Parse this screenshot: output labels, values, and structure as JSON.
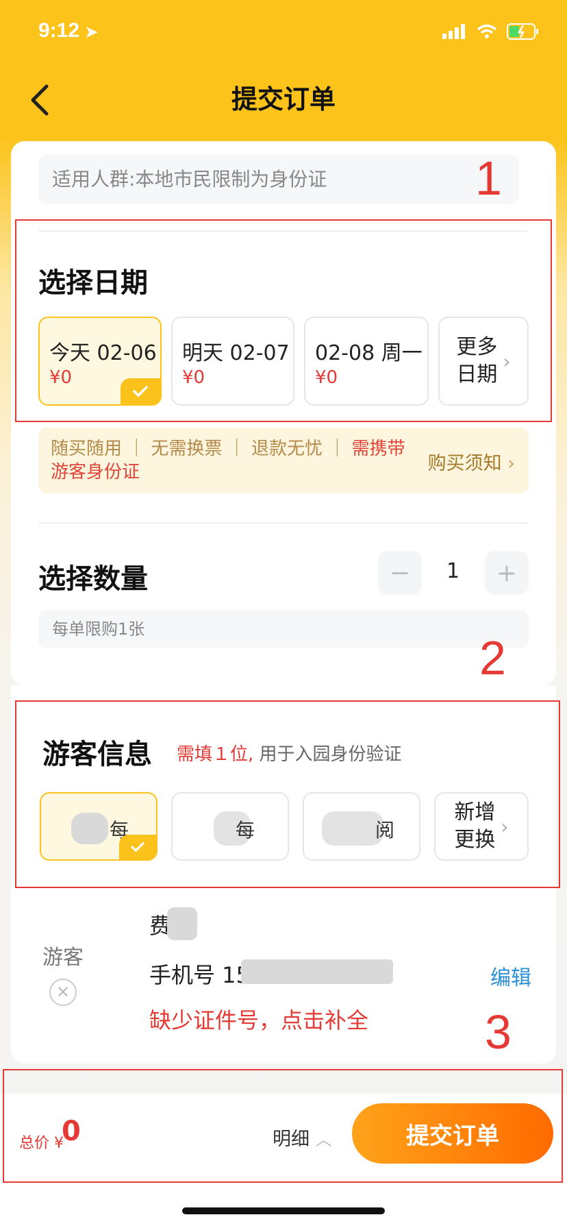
{
  "status_bar": {
    "time": "9:12"
  },
  "nav": {
    "title": "提交订单"
  },
  "applicable": {
    "text": "适用人群:本地市民限制为身份证"
  },
  "annotations": [
    "1",
    "2",
    "3"
  ],
  "date_section": {
    "title": "选择日期",
    "options": [
      {
        "label": "今天 02-06",
        "price": "¥0",
        "selected": true
      },
      {
        "label": "明天 02-07",
        "price": "¥0",
        "selected": false
      },
      {
        "label": "02-08 周一",
        "price": "¥0",
        "selected": false
      }
    ],
    "more_line1": "更多",
    "more_line2": "日期"
  },
  "ticket_notice": {
    "text": "随买随用 ｜ 无需换票 ｜ 退款无忧 ｜ ",
    "red_text": "需携带游客身份证",
    "link": "购买须知"
  },
  "quantity_section": {
    "title": "选择数量",
    "value": "1",
    "minus": "−",
    "plus": "+",
    "limit_note": "每单限购1张"
  },
  "visitor_section": {
    "title": "游客信息",
    "required": "需填１位,",
    "hint": "用于入园身份验证",
    "visitors": [
      {
        "name": "每",
        "selected": true
      },
      {
        "name": "每",
        "selected": false
      },
      {
        "name": "阅",
        "selected": false
      }
    ],
    "add_line1": "新增",
    "add_line2": "更换"
  },
  "traveler": {
    "label": "游客",
    "name": "费",
    "phone": "手机号 15",
    "warning": "缺少证件号，点击补全",
    "edit": "编辑"
  },
  "bottom_bar": {
    "total_label": "总价 ¥",
    "total_value": "0",
    "detail": "明细",
    "submit": "提交订单"
  },
  "colors": {
    "brand": "#fcc31a",
    "accent": "#ff6a00",
    "warning": "#e53935",
    "link": "#2b8fd6"
  }
}
